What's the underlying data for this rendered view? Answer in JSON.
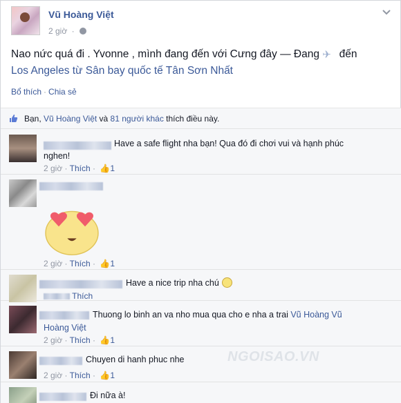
{
  "post": {
    "author": "Vũ Hoàng Việt",
    "time": "2 giờ",
    "status_part1": "Nao nức quá đi . Yvonne , mình đang đến với Cưng đây",
    "status_sep": " — Đang ",
    "status_part2": " đến",
    "status_location": "Los Angeles từ Sân bay quốc tế Tân Sơn Nhất",
    "action_like": "Bổ thích",
    "action_share": "Chia sẻ",
    "likes_prefix": "Bạn, ",
    "likes_name": "Vũ Hoàng Việt",
    "likes_and": " và ",
    "likes_others": "81 người khác",
    "likes_suffix": " thích điều này."
  },
  "comments": [
    {
      "text": "Have a safe flight nha bạn! Qua đó đi chơi vui và hạnh phúc nghen!",
      "text_line1": "Have a safe flight nha bạn! Qua đó đi chơi vui và hạnh phúc",
      "text_line2": "nghen!",
      "time": "2 giờ",
      "like_label": "Thích",
      "like_count": "1"
    },
    {
      "text": "",
      "time": "2 giờ",
      "like_label": "Thích",
      "like_count": "1",
      "sticker": "heart-eyes-emoji"
    },
    {
      "text": "Have a nice trip nha chú",
      "time": "",
      "like_label": "Thích"
    },
    {
      "text_line1": "Thuong lo binh an va nho mua qua cho e nha a trai ",
      "mention_part1": "Vũ Hoàng",
      "mention_part1b": "Vũ",
      "mention_part2": "Hoàng Việt",
      "time": "2 giờ",
      "like_label": "Thích",
      "like_count": "1"
    },
    {
      "text": "Chuyen di hanh phuc nhe",
      "time": "2 giờ",
      "like_label": "Thích",
      "like_count": "1"
    },
    {
      "text": "Đi nữa à!"
    }
  ],
  "watermark": "NGOISAO.VN",
  "icons": {
    "globe": "globe-icon",
    "chevron": "chevron-down-icon",
    "plane": "airplane-icon",
    "like": "thumbs-up-icon",
    "smiley": "smiley-icon"
  },
  "colors": {
    "link": "#3b5998",
    "meta": "#9197a3",
    "comment_bg": "#f6f7f9"
  }
}
